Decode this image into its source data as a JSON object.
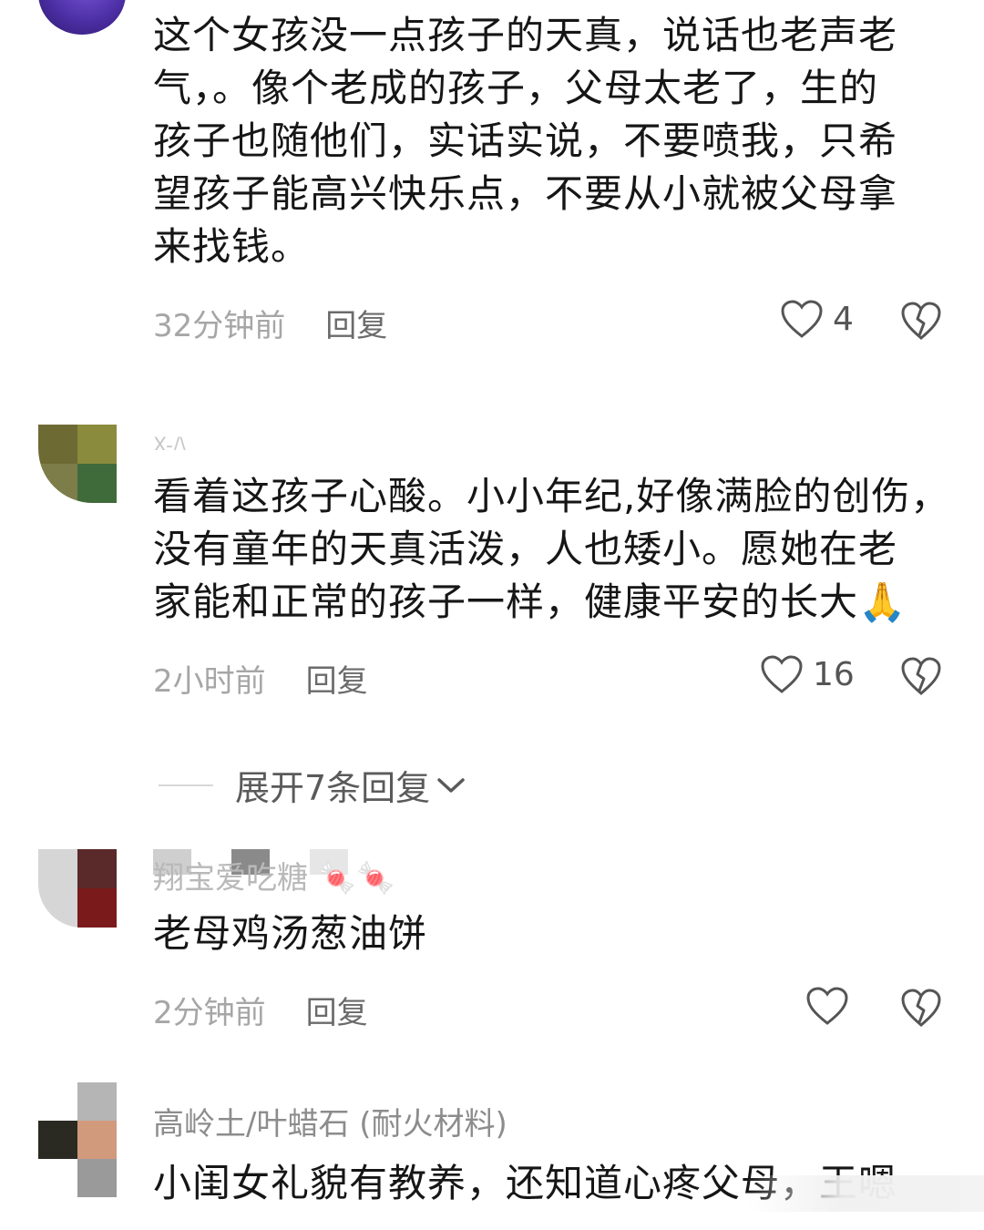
{
  "comments": [
    {
      "name": "",
      "text_lines": [
        "这个女孩没一点孩子的天真，说话也老声老",
        "气，。像个老成的孩子，父母太老了，生的",
        "孩子也随他们，实话实说，不要喷我，只希",
        "望孩子能高兴快乐点，不要从小就被父母拿",
        "来找钱。"
      ],
      "time": "32分钟前",
      "reply_label": "回复",
      "likes": "4"
    },
    {
      "name": "X-/\\",
      "text_lines": [
        "看着这孩子心酸。小小年纪,好像满脸的创伤，",
        "没有童年的天真活泼，人也矮小。愿她在老",
        "家能和正常的孩子一样，健康平安的长大🙏"
      ],
      "time": "2小时前",
      "reply_label": "回复",
      "likes": "16",
      "expand_label": "展开7条回复"
    },
    {
      "name": "翔宝爱吃糖 🍬🍬",
      "text_lines": [
        "老母鸡汤葱油饼"
      ],
      "time": "2分钟前",
      "reply_label": "回复",
      "likes": ""
    },
    {
      "name": "高岭土/叶蜡石 (耐火材料)",
      "text_lines": [
        "小闺女礼貌有教养，还知道心疼父母，王嗯"
      ]
    }
  ],
  "colors": {
    "text": "#161616",
    "secondary": "#a6a6a6",
    "reply": "#6b6b6b",
    "icon": "#555555"
  },
  "icons": {
    "like": "heart-outline-icon",
    "dislike": "broken-heart-icon",
    "expand": "chevron-down-icon"
  }
}
